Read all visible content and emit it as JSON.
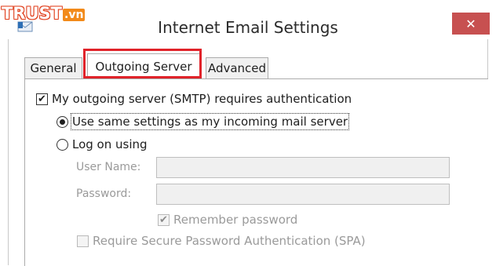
{
  "watermark": {
    "brand": "TRUST",
    "tld": ".vn"
  },
  "window": {
    "title": "Internet Email Settings",
    "close_glyph": "✕"
  },
  "tabs": [
    {
      "label": "General",
      "selected": false
    },
    {
      "label": "Outgoing Server",
      "selected": true
    },
    {
      "label": "Advanced",
      "selected": false
    }
  ],
  "outgoing": {
    "requires_auth": {
      "label": "My outgoing server (SMTP) requires authentication",
      "checked": true
    },
    "use_same": {
      "label": "Use same settings as my incoming mail server",
      "selected": true
    },
    "log_on": {
      "label": "Log on using",
      "selected": false
    },
    "user_name": {
      "label": "User Name:",
      "value": "",
      "enabled": false
    },
    "password": {
      "label": "Password:",
      "value": "",
      "enabled": false
    },
    "remember_password": {
      "label": "Remember password",
      "checked": true,
      "enabled": false
    },
    "spa": {
      "label": "Require Secure Password Authentication (SPA)",
      "checked": false,
      "enabled": false
    }
  },
  "colors": {
    "close_button": "#c75050",
    "highlight_border": "#e0232a",
    "disabled_text": "#9a9a9a"
  },
  "icons": {
    "app": "outlook-envelope-icon",
    "check": "checkmark-icon"
  }
}
